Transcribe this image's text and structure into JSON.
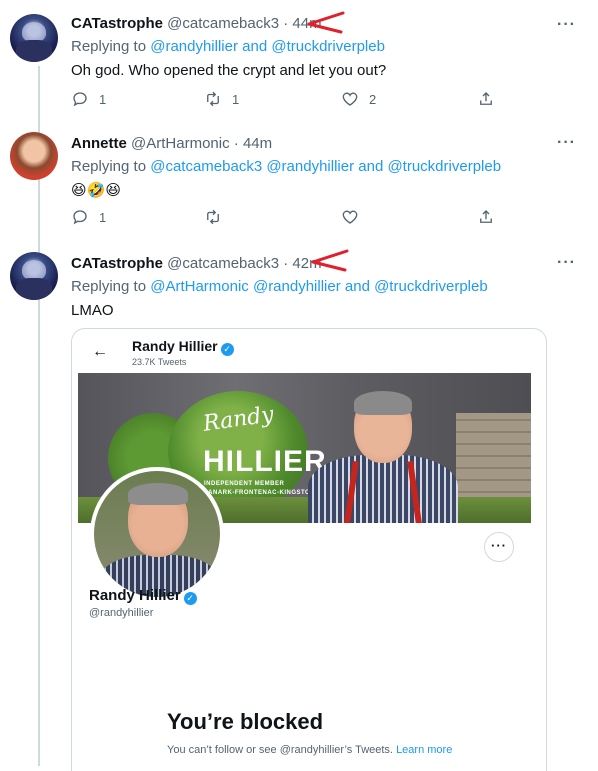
{
  "tweets": [
    {
      "name": "CATastrophe",
      "handle": "@catcameback3",
      "time": "44m",
      "replying_prefix": "Replying to",
      "replying_to": "@randyhillier and @truckdriverpleb",
      "text": "Oh god. Who opened the crypt and let you out?",
      "replies": "1",
      "retweets": "1",
      "likes": "2"
    },
    {
      "name": "Annette",
      "handle": "@ArtHarmonic",
      "time": "44m",
      "replying_prefix": "Replying to",
      "replying_to": "@catcameback3 @randyhillier and @truckdriverpleb",
      "text": "😆🤣😆",
      "replies": "1",
      "retweets": "",
      "likes": ""
    },
    {
      "name": "CATastrophe",
      "handle": "@catcameback3",
      "time": "42m",
      "replying_prefix": "Replying to",
      "replying_to": "@ArtHarmonic @randyhillier and @truckdriverpleb",
      "text": "LMAO"
    }
  ],
  "dot": "·",
  "more": "···",
  "screenshot_card": {
    "profile_name": "Randy Hillier",
    "tweet_count": "23.7K Tweets",
    "banner_script": "Randy",
    "banner_last": "HILLIER",
    "banner_line1": "INDEPENDENT MEMBER",
    "banner_line2": "LANARK-FRONTENAC-KINGSTON",
    "handle": "@randyhillier",
    "more_button": "···",
    "blocked_title": "You’re blocked",
    "blocked_text": "You can’t follow or see @randyhillier’s Tweets.",
    "learn_more": "Learn more"
  },
  "colors": {
    "link": "#1d9bf0",
    "secondary_text": "#536471",
    "annotation": "#e0202a"
  }
}
